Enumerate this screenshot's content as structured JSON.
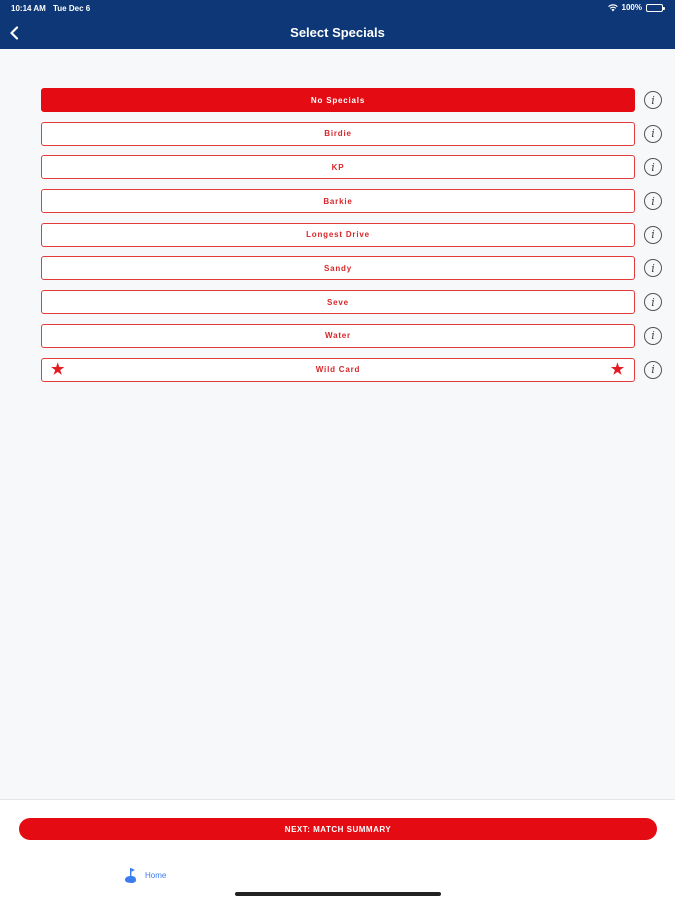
{
  "status_bar": {
    "time": "10:14 AM",
    "date": "Tue Dec 6",
    "battery": "100%"
  },
  "header": {
    "title": "Select Specials",
    "back_icon": "chevron-left-icon",
    "background_color": "#0d3776"
  },
  "specials": [
    {
      "label": "No Specials",
      "selected": true
    },
    {
      "label": "Birdie",
      "selected": false
    },
    {
      "label": "KP",
      "selected": false
    },
    {
      "label": "Barkie",
      "selected": false
    },
    {
      "label": "Longest Drive",
      "selected": false
    },
    {
      "label": "Sandy",
      "selected": false
    },
    {
      "label": "Seve",
      "selected": false
    },
    {
      "label": "Water",
      "selected": false
    },
    {
      "label": "Wild Card",
      "selected": false,
      "stars": true
    }
  ],
  "info_icon": "info-icon",
  "footer": {
    "next_label": "NEXT: MATCH SUMMARY",
    "home_label": "Home",
    "home_icon": "golf-flag-icon"
  },
  "colors": {
    "accent_red": "#e50b13",
    "nav_blue": "#0d3776",
    "link_blue": "#3d7cf0"
  }
}
